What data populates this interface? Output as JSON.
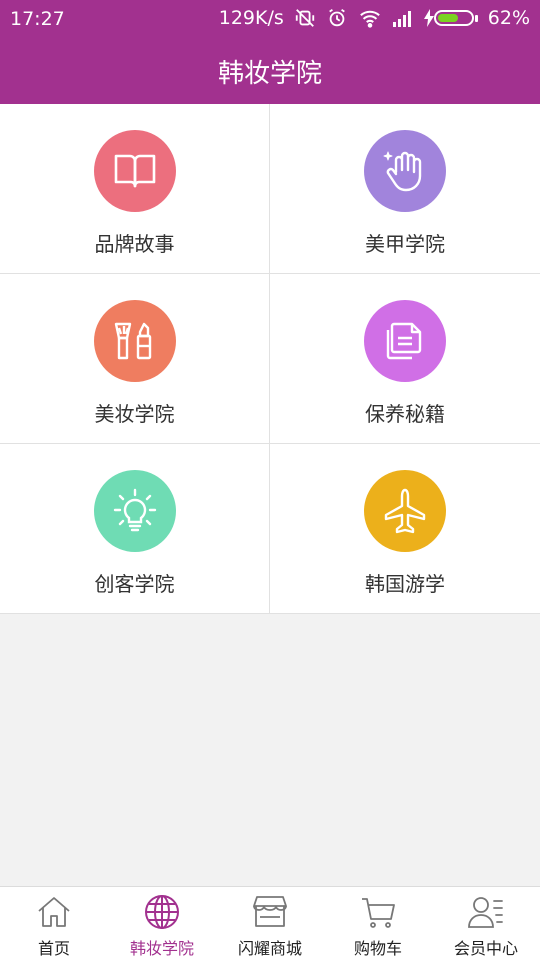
{
  "status_bar": {
    "time": "17:27",
    "net_speed": "129K/s",
    "battery": "62%",
    "battery_level": 0.62
  },
  "header": {
    "title": "韩妆学院"
  },
  "grid": {
    "items": [
      {
        "label": "品牌故事",
        "icon": "book-icon",
        "color": "#ec6f7e"
      },
      {
        "label": "美甲学院",
        "icon": "hand-icon",
        "color": "#a184dc"
      },
      {
        "label": "美妆学院",
        "icon": "makeup-brush-icon",
        "color": "#ef7d60"
      },
      {
        "label": "保养秘籍",
        "icon": "documents-icon",
        "color": "#d06fe6"
      },
      {
        "label": "创客学院",
        "icon": "lightbulb-icon",
        "color": "#6fdcb4"
      },
      {
        "label": "韩国游学",
        "icon": "airplane-icon",
        "color": "#ecb01b"
      }
    ]
  },
  "tabbar": {
    "items": [
      {
        "label": "首页",
        "icon": "home-icon"
      },
      {
        "label": "韩妆学院",
        "icon": "globe-icon",
        "active": true
      },
      {
        "label": "闪耀商城",
        "icon": "store-icon"
      },
      {
        "label": "购物车",
        "icon": "cart-icon"
      },
      {
        "label": "会员中心",
        "icon": "member-icon"
      }
    ]
  },
  "colors": {
    "brand": "#a2318f",
    "tab_active": "#a2318f"
  }
}
